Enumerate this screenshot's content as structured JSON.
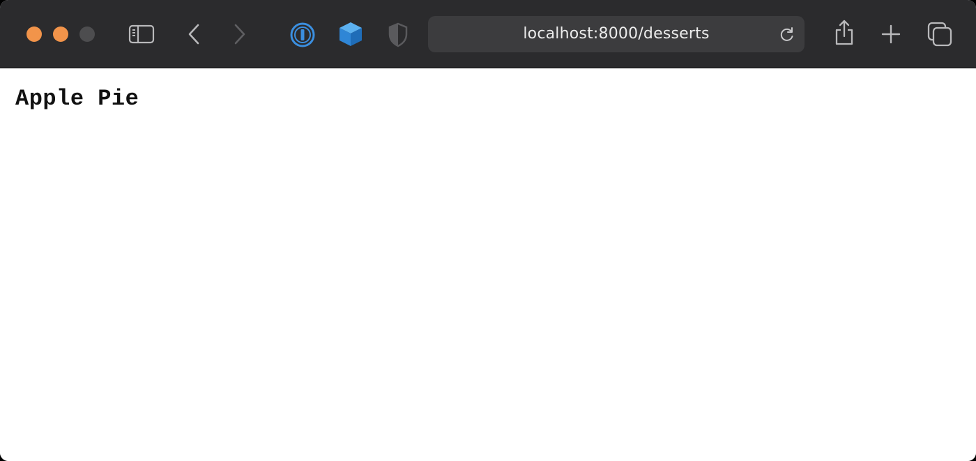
{
  "browser": {
    "address": {
      "url": "localhost:8000/desserts"
    },
    "traffic_lights": {
      "close_color": "#f2944a",
      "minimize_color": "#f2944a",
      "zoom_color": "#4d4d4f"
    },
    "toolbar_icons": [
      "sidebar-icon",
      "back-chevron-icon",
      "forward-chevron-icon",
      "password-manager-icon",
      "cube-extension-icon",
      "shield-extension-icon",
      "reload-icon",
      "share-icon",
      "new-tab-plus-icon",
      "tab-overview-icon"
    ]
  },
  "page": {
    "text": "Apple Pie"
  }
}
